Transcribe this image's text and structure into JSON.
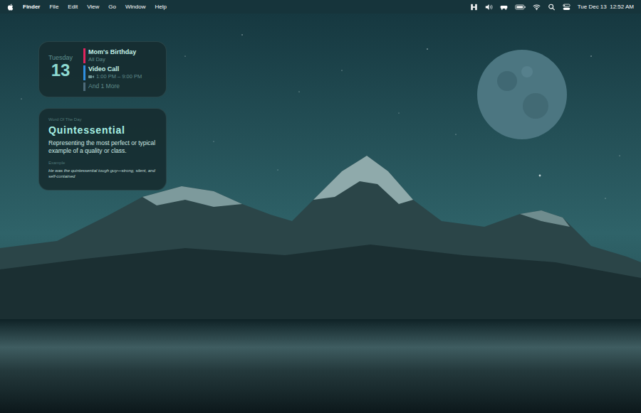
{
  "menu_bar": {
    "app": "Finder",
    "items": [
      "File",
      "Edit",
      "View",
      "Go",
      "Window",
      "Help"
    ],
    "clock": "Tue Dec 13  12:52 AM"
  },
  "calendar_widget": {
    "weekday": "Tuesday",
    "day": "13",
    "events": [
      {
        "title": "Mom's Birthday",
        "time": "All Day",
        "video": false,
        "color": "#e0245e"
      },
      {
        "title": "Video Call",
        "time": "1:00 PM – 9:00 PM",
        "video": true,
        "color": "#2f8fe0"
      }
    ],
    "more": {
      "label": "And 1 More",
      "color": "#4d6b7a"
    }
  },
  "word_widget": {
    "label": "Word Of The Day",
    "word": "Quintessential",
    "definition": "Representing the most perfect or typical example of a quality or class.",
    "example_label": "Example",
    "example": "He was the quintessential tough guy—strong, silent, and self-contained"
  }
}
